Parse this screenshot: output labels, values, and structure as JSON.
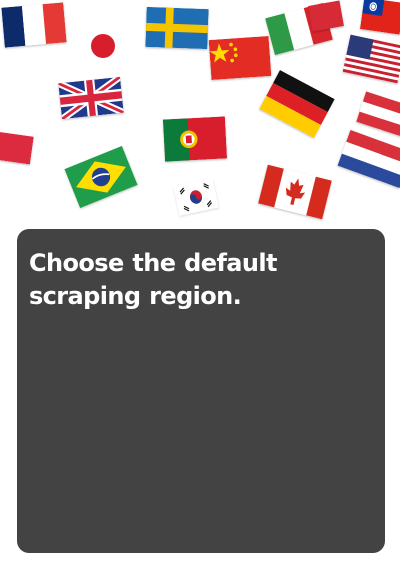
{
  "prompt": {
    "text": "Choose the default scraping region."
  },
  "flags": [
    {
      "name": "france-flag"
    },
    {
      "name": "japan-flag"
    },
    {
      "name": "sweden-flag"
    },
    {
      "name": "china-flag"
    },
    {
      "name": "italy-flag"
    },
    {
      "name": "red-white-flag"
    },
    {
      "name": "taiwan-flag"
    },
    {
      "name": "usa-flag"
    },
    {
      "name": "united-kingdom-flag"
    },
    {
      "name": "germany-flag"
    },
    {
      "name": "austria-flag"
    },
    {
      "name": "poland-flag"
    },
    {
      "name": "portugal-flag"
    },
    {
      "name": "netherlands-flag"
    },
    {
      "name": "brazil-flag"
    },
    {
      "name": "south-korea-flag"
    },
    {
      "name": "canada-flag"
    }
  ],
  "colors": {
    "panel_background": "#434343",
    "prompt_text": "#ffffff",
    "page_background": "#ffffff"
  }
}
